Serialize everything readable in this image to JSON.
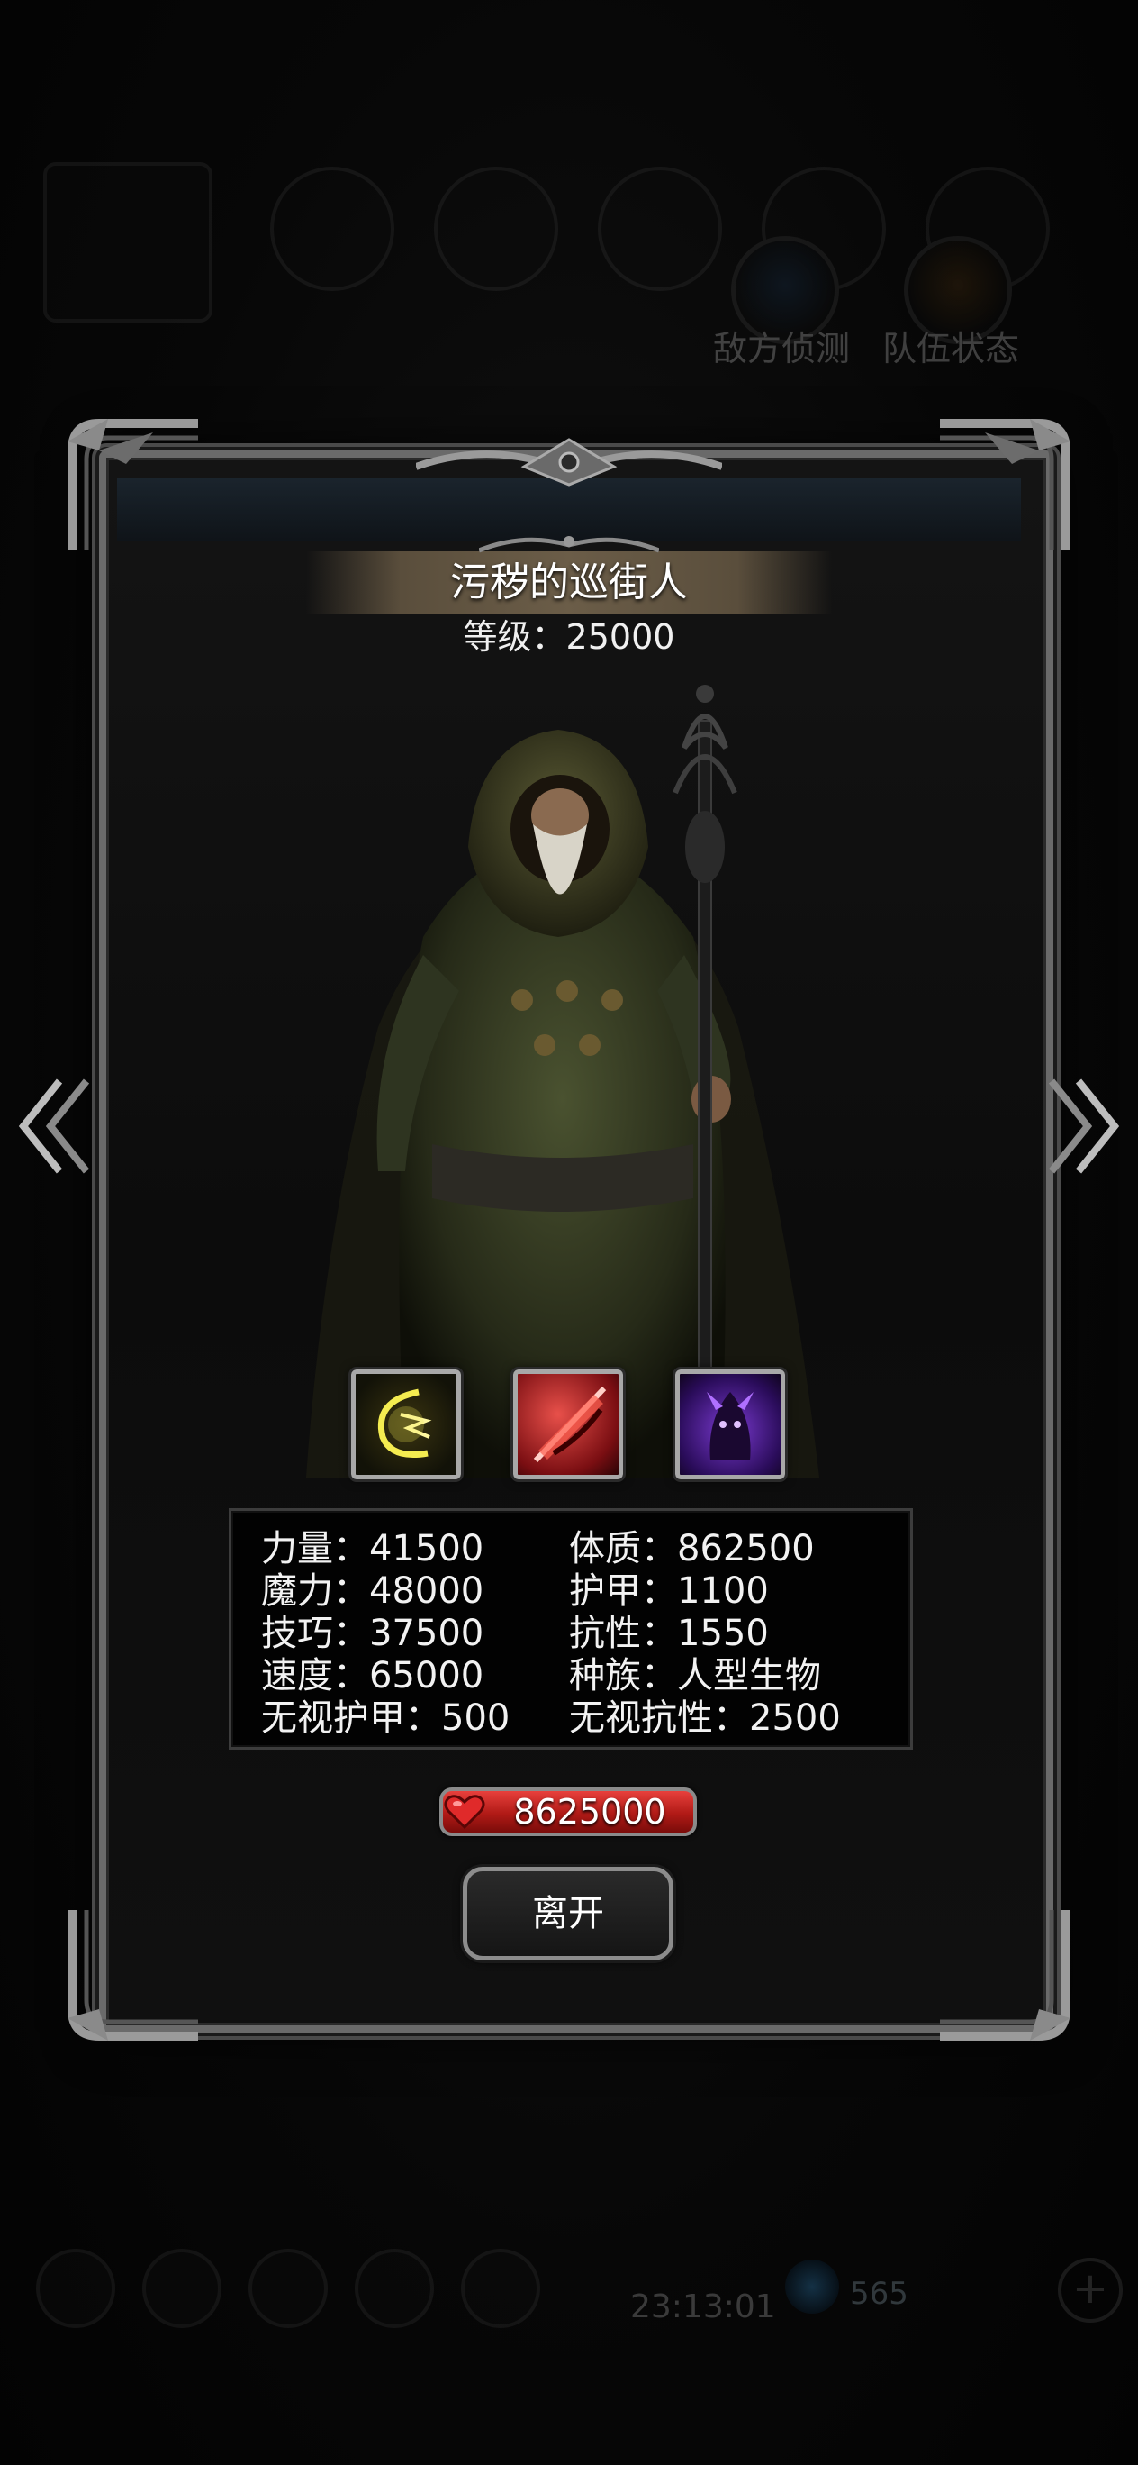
{
  "background_hud": {
    "labels": [
      "敌方侦测",
      "队伍状态"
    ],
    "clock": "23:13:01",
    "gem_count": "565"
  },
  "monster": {
    "name": "污秽的巡街人",
    "level_text": "等级：25000"
  },
  "skills": [
    {
      "icon": "lightning-arc-icon",
      "color": "#e8e040"
    },
    {
      "icon": "blood-slash-icon",
      "color": "#d82828"
    },
    {
      "icon": "shadow-demon-icon",
      "color": "#8a40e0"
    }
  ],
  "stats": {
    "left": [
      "力量：41500",
      "魔力：48000",
      "技巧：37500",
      "速度：65000",
      "无视护甲：500"
    ],
    "right": [
      "体质：862500",
      "护甲：1100",
      "抗性：1550",
      "种族：人型生物",
      "无视抗性：2500"
    ]
  },
  "hp": {
    "icon": "heart-icon",
    "value": "8625000",
    "color": "#d8281f"
  },
  "actions": {
    "leave_label": "离开"
  },
  "navigation": {
    "prev_icon": "double-chevron-left-icon",
    "next_icon": "double-chevron-right-icon"
  }
}
